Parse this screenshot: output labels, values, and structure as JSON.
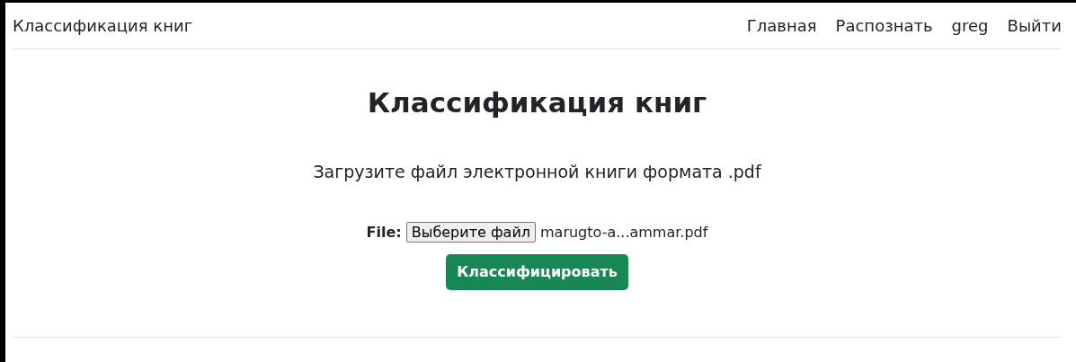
{
  "navbar": {
    "brand": "Классификация книг",
    "links": [
      {
        "label": "Главная"
      },
      {
        "label": "Распознать"
      },
      {
        "label": "greg"
      },
      {
        "label": "Выйти"
      }
    ]
  },
  "main": {
    "title": "Классификация книг",
    "subtitle": "Загрузите файл электронной книги формата .pdf",
    "file_label": "File:",
    "file_button": "Выберите файл",
    "file_name": "marugto-a...ammar.pdf",
    "submit": "Классифицировать"
  }
}
